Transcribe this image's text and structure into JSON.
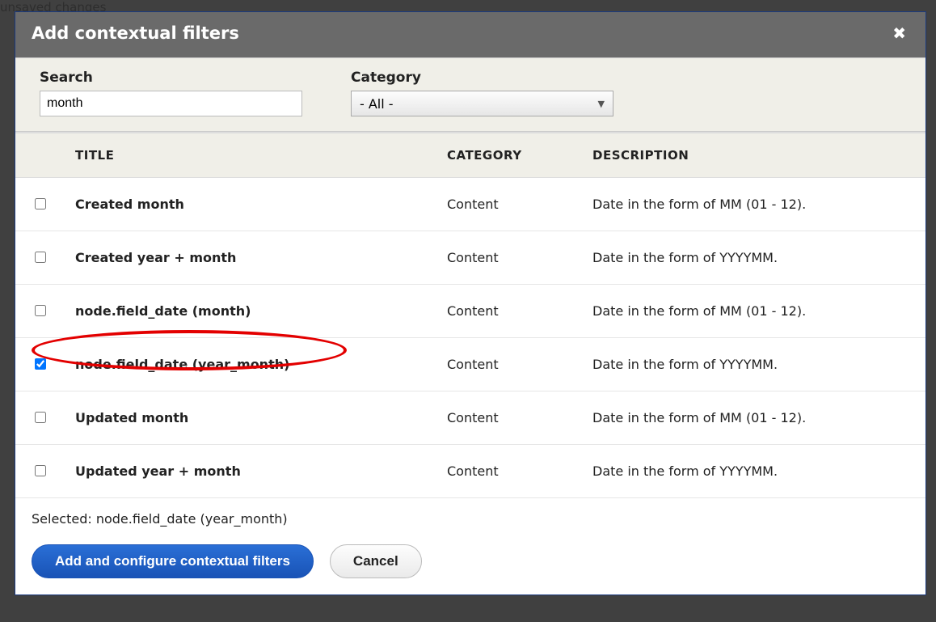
{
  "backdrop": {
    "unsaved": "unsaved changes"
  },
  "dialog": {
    "title": "Add contextual filters",
    "close_glyph": "✖"
  },
  "filters": {
    "search_label": "Search",
    "search_value": "month",
    "category_label": "Category",
    "category_value": "- All -",
    "dropdown_glyph": "▼"
  },
  "table": {
    "headers": {
      "title": "TITLE",
      "category": "CATEGORY",
      "description": "DESCRIPTION"
    },
    "rows": [
      {
        "checked": false,
        "title": "Created month",
        "category": "Content",
        "description": "Date in the form of MM (01 - 12)."
      },
      {
        "checked": false,
        "title": "Created year + month",
        "category": "Content",
        "description": "Date in the form of YYYYMM."
      },
      {
        "checked": false,
        "title": "node.field_date (month)",
        "category": "Content",
        "description": "Date in the form of MM (01 - 12)."
      },
      {
        "checked": true,
        "title": "node.field_date (year_month)",
        "category": "Content",
        "description": "Date in the form of YYYYMM."
      },
      {
        "checked": false,
        "title": "Updated month",
        "category": "Content",
        "description": "Date in the form of MM (01 - 12)."
      },
      {
        "checked": false,
        "title": "Updated year + month",
        "category": "Content",
        "description": "Date in the form of YYYYMM."
      }
    ]
  },
  "annotation": {
    "circled_row_index": 3
  },
  "footer": {
    "selected_prefix": "Selected: ",
    "selected_value": "node.field_date (year_month)",
    "primary_label": "Add and configure contextual filters",
    "cancel_label": "Cancel"
  }
}
